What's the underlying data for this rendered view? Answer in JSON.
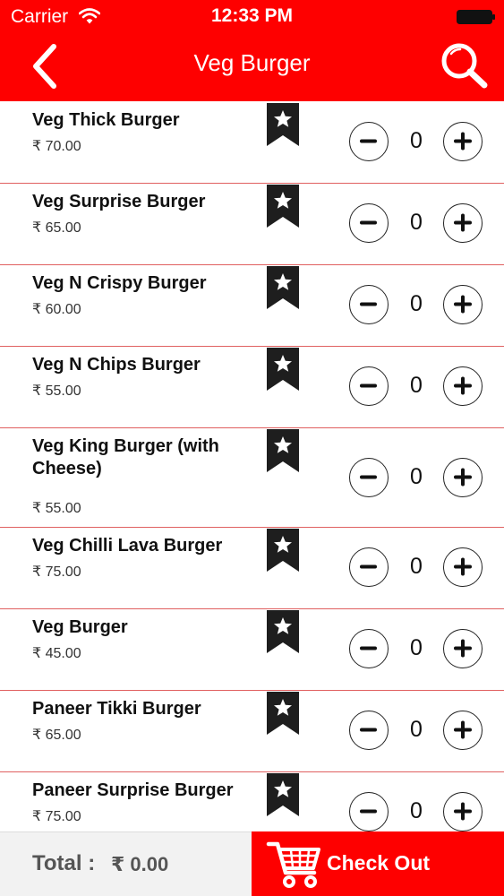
{
  "status_bar": {
    "carrier": "Carrier",
    "time": "12:33 PM",
    "wifi_icon": "wifi-icon",
    "battery_icon": "battery-icon"
  },
  "nav": {
    "title": "Veg Burger",
    "back_icon": "chevron-left-icon",
    "search_icon": "search-icon"
  },
  "items": [
    {
      "name": "Veg Thick Burger",
      "price": "₹ 70.00",
      "qty": "0"
    },
    {
      "name": "Veg Surprise Burger",
      "price": "₹ 65.00",
      "qty": "0"
    },
    {
      "name": "Veg N Crispy Burger",
      "price": "₹ 60.00",
      "qty": "0"
    },
    {
      "name": "Veg N Chips Burger",
      "price": "₹ 55.00",
      "qty": "0"
    },
    {
      "name": "Veg King Burger (with Cheese)",
      "price": "₹ 55.00",
      "qty": "0"
    },
    {
      "name": "Veg Chilli Lava Burger",
      "price": "₹ 75.00",
      "qty": "0"
    },
    {
      "name": "Veg Burger",
      "price": "₹ 45.00",
      "qty": "0"
    },
    {
      "name": "Paneer Tikki Burger",
      "price": "₹ 65.00",
      "qty": "0"
    },
    {
      "name": "Paneer Surprise Burger",
      "price": "₹ 75.00",
      "qty": "0"
    }
  ],
  "footer": {
    "total_label": "Total :",
    "total_value": "₹ 0.00",
    "checkout_label": "Check Out",
    "cart_icon": "shopping-cart-icon"
  },
  "colors": {
    "brand_red": "#fe0000",
    "divider": "#e06060",
    "footer_bg": "#f2f2f2"
  }
}
